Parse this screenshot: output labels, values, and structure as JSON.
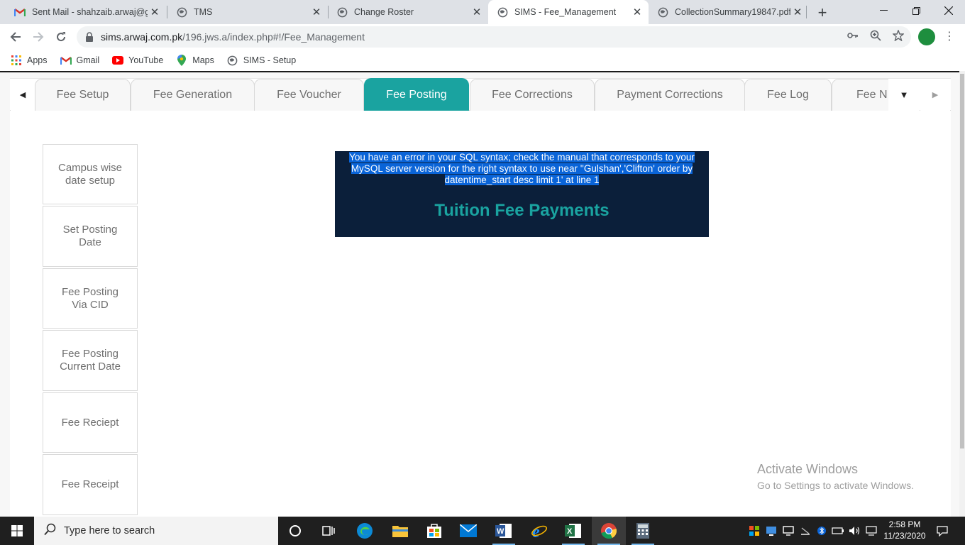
{
  "browser": {
    "tabs": [
      {
        "title": "Sent Mail - shahzaib.arwaj@gr",
        "icon": "gmail-icon",
        "active": false
      },
      {
        "title": "TMS",
        "icon": "globe-icon",
        "active": false
      },
      {
        "title": "Change Roster",
        "icon": "globe-icon",
        "active": false
      },
      {
        "title": "SIMS - Fee_Management",
        "icon": "globe-icon",
        "active": true
      },
      {
        "title": "CollectionSummary19847.pdf",
        "icon": "globe-icon",
        "active": false
      }
    ],
    "url_host": "sims.arwaj.com.pk",
    "url_path": "/196.jws.a/index.php#!/Fee_Management",
    "bookmarks": [
      {
        "label": "Apps",
        "icon": "apps-grid-icon"
      },
      {
        "label": "Gmail",
        "icon": "gmail-icon"
      },
      {
        "label": "YouTube",
        "icon": "youtube-icon"
      },
      {
        "label": "Maps",
        "icon": "maps-pin-icon"
      },
      {
        "label": "SIMS - Setup",
        "icon": "globe-icon"
      }
    ]
  },
  "app": {
    "nav_tabs": [
      {
        "label": "Fee Setup",
        "active": false
      },
      {
        "label": "Fee Generation",
        "active": false
      },
      {
        "label": "Fee Voucher",
        "active": false
      },
      {
        "label": "Fee Posting",
        "active": true
      },
      {
        "label": "Fee Corrections",
        "active": false
      },
      {
        "label": "Payment Corrections",
        "active": false
      },
      {
        "label": "Fee Log",
        "active": false
      },
      {
        "label": "Fee N",
        "active": false
      }
    ],
    "side_buttons": [
      "Campus wise date setup",
      "Set Posting Date",
      "Fee Posting Via CID",
      "Fee Posting Current Date",
      "Fee Reciept",
      "Fee Receipt"
    ],
    "error_message": "You have an error in your SQL syntax; check the manual that corresponds to your MySQL server version for the right syntax to use near ''Gulshan','Clifton' order by datentime_start desc limit 1' at line 1",
    "panel_title": "Tuition Fee Payments"
  },
  "watermark": {
    "line1": "Activate Windows",
    "line2": "Go to Settings to activate Windows."
  },
  "taskbar": {
    "search_placeholder": "Type here to search",
    "time": "2:58 PM",
    "date": "11/23/2020"
  },
  "colors": {
    "accent": "#1aa3a0",
    "panel_bg": "#0b1f3a",
    "selection": "#0a64d8"
  }
}
